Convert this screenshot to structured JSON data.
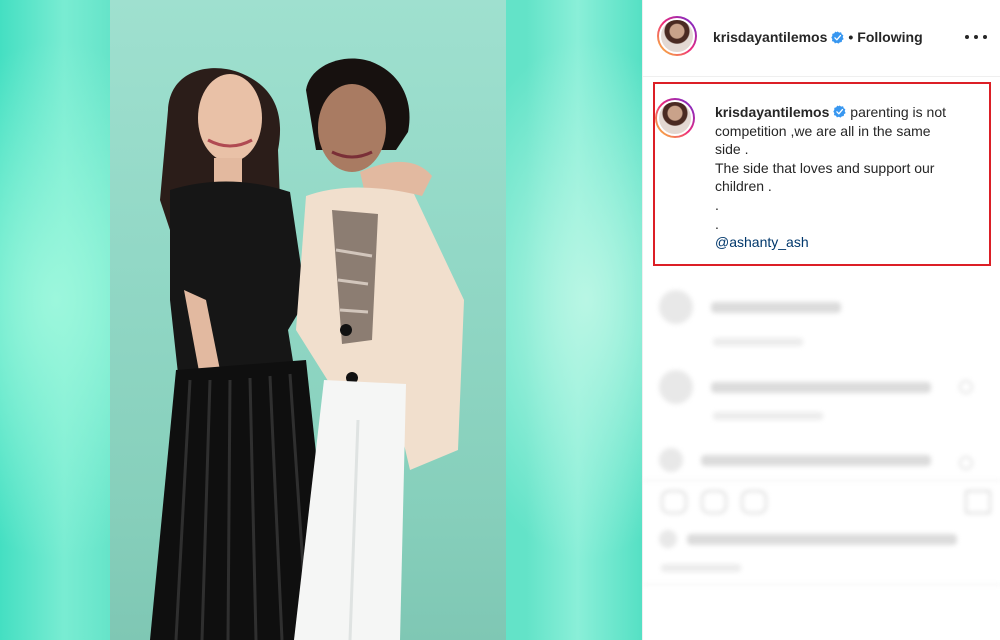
{
  "post": {
    "username": "krisdayantilemos",
    "separator": "•",
    "follow_status": "Following"
  },
  "caption": {
    "username": "krisdayantilemos",
    "lines": [
      "parenting is not",
      "competition ,we are all in the same",
      "side .",
      "The side that loves and support our",
      "children .",
      ".",
      "."
    ],
    "mention": "@ashanty_ash"
  },
  "icons": {
    "verified": "verified-badge-icon",
    "more": "more-options-icon"
  },
  "colors": {
    "highlight_border": "#dc1f26",
    "verified_blue": "#3897f0",
    "mention_link": "#00376b",
    "photo_background": "#63e3c8"
  }
}
